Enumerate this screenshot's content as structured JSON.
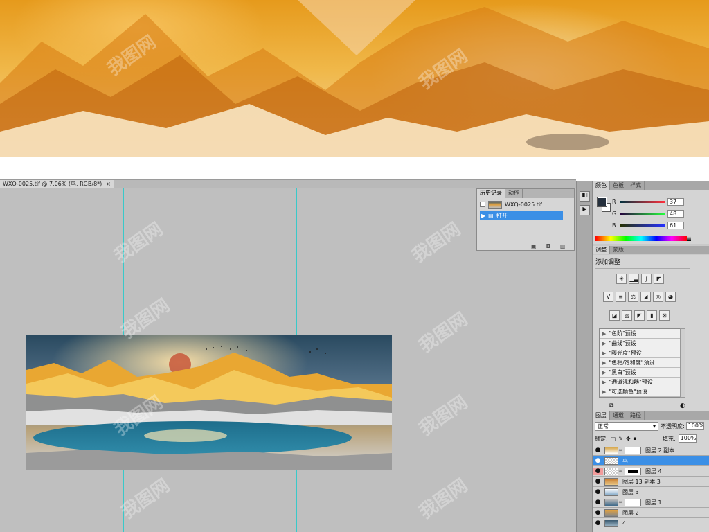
{
  "document_tab": {
    "title": "WXQ-0025.tif @ 7.06% (鸟, RGB/8*)",
    "close": "×"
  },
  "history_panel": {
    "tabs": [
      "历史记录",
      "动作"
    ],
    "snapshot": "WXQ-0025.tif",
    "states": [
      "打开"
    ]
  },
  "color_panel": {
    "tabs": [
      "颜色",
      "色板",
      "样式"
    ],
    "rgb": [
      {
        "channel": "R",
        "value": "37"
      },
      {
        "channel": "G",
        "value": "48"
      },
      {
        "channel": "B",
        "value": "61"
      }
    ],
    "foreground_color": "#25303d"
  },
  "adjustments_panel": {
    "tabs": [
      "调整",
      "蒙版"
    ],
    "title": "添加调整",
    "presets": [
      "\"色阶\"预设",
      "\"曲线\"预设",
      "\"曝光度\"预设",
      "\"色相/饱和度\"预设",
      "\"黑白\"预设",
      "\"通道混和器\"预设",
      "\"可选颜色\"预设"
    ]
  },
  "layers_panel": {
    "tabs": [
      "图层",
      "通道",
      "路径"
    ],
    "blend_mode": "正常",
    "opacity_label": "不透明度:",
    "opacity": "100%",
    "lock_label": "锁定:",
    "fill_label": "填充:",
    "fill": "100%",
    "layers": [
      {
        "name": "图层 2 副本"
      },
      {
        "name": "鸟"
      },
      {
        "name": "图层 4"
      },
      {
        "name": "图层 13 副本 3"
      },
      {
        "name": "图层 3"
      },
      {
        "name": "图层 1"
      },
      {
        "name": "图层 2"
      },
      {
        "name": "4"
      }
    ]
  },
  "watermark": "我图网"
}
